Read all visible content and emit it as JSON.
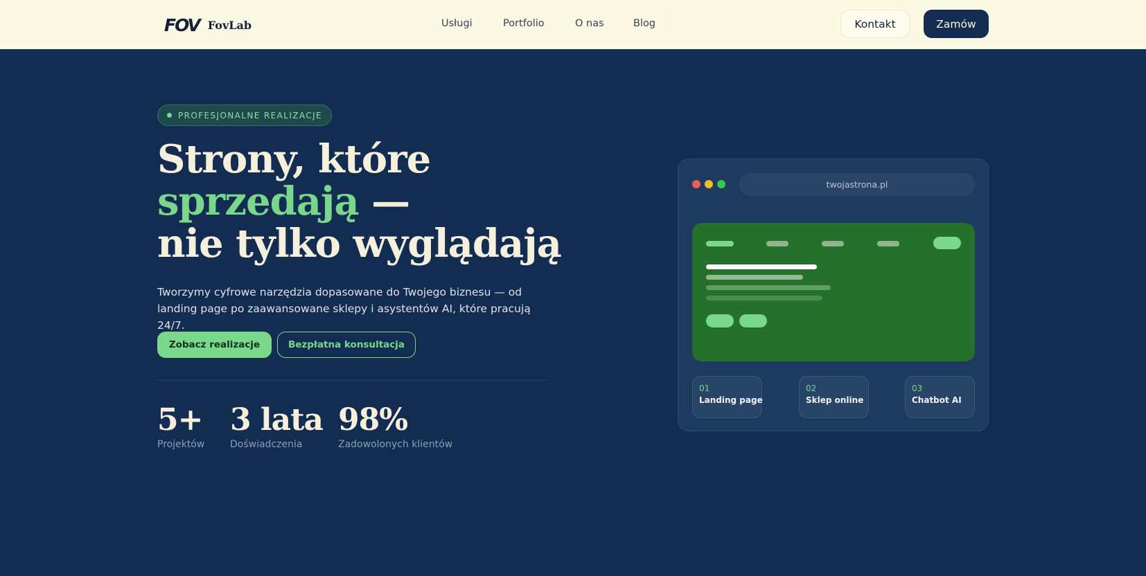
{
  "header": {
    "logo_mark": "FOV",
    "brand": "FovLab",
    "nav": [
      "Usługi",
      "Portfolio",
      "O nas",
      "Blog"
    ],
    "contact_label": "Kontakt",
    "order_label": "Zamów"
  },
  "hero": {
    "badge": "PROFESJONALNE REALIZACJE",
    "title_line1": "Strony, które",
    "title_accent": "sprzedają",
    "title_dash": " —",
    "title_line3": "nie tylko wyglądają",
    "lead": "Tworzymy cyfrowe narzędzia dopasowane do Twojego biznesu — od landing page po zaawansowane sklepy i asystentów AI, które pracują 24/7.",
    "primary_cta": "Zobacz realizacje",
    "secondary_cta": "Bezpłatna konsultacja",
    "stats": [
      {
        "value": "5+",
        "label": "Projektów"
      },
      {
        "value": "3 lata",
        "label": "Doświadczenia"
      },
      {
        "value": "98%",
        "label": "Zadowolonych klientów"
      }
    ]
  },
  "mockup": {
    "url": "twojastrona.pl",
    "window_dot_colors": [
      "#ec5f57",
      "#f3bc2f",
      "#36c94b"
    ],
    "screen_color": "#24702c",
    "accent_color": "#7ad88b",
    "cards": [
      {
        "num": "01",
        "label": "Landing page"
      },
      {
        "num": "02",
        "label": "Sklep online"
      },
      {
        "num": "03",
        "label": "Chatbot AI"
      }
    ]
  }
}
